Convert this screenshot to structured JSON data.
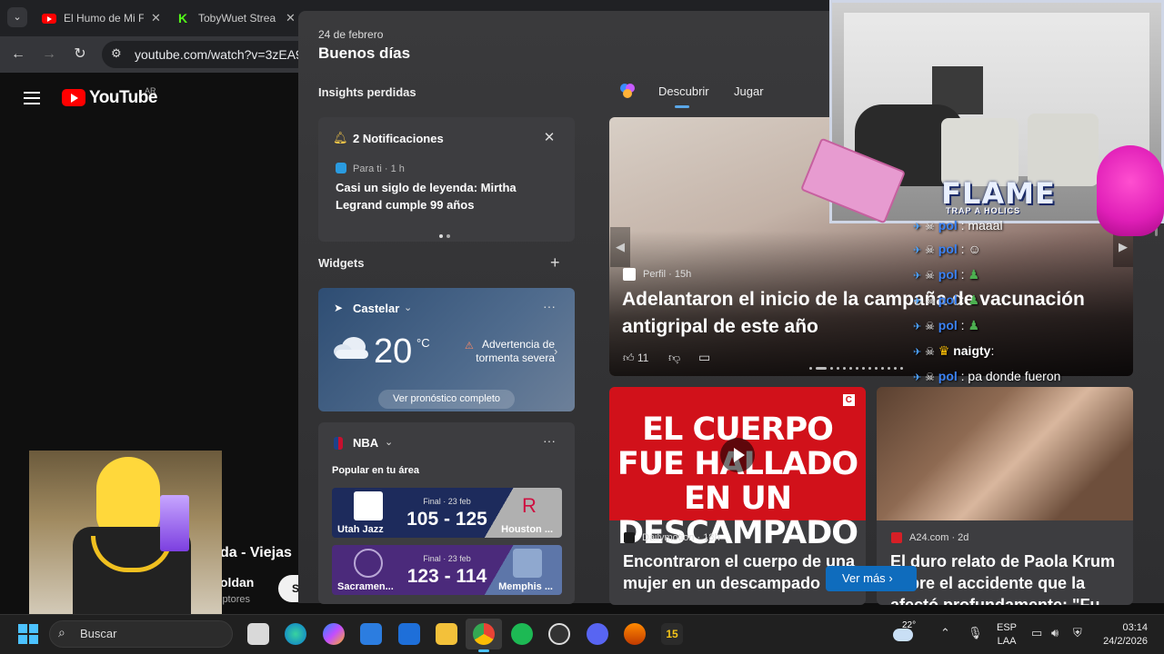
{
  "browser": {
    "tabs": [
      {
        "title": "El Humo de Mi F",
        "icon": "youtube-icon"
      },
      {
        "title": "TobyWuet Strea",
        "icon": "kick-icon"
      }
    ],
    "url": "youtube.com/watch?v=3zEA9T"
  },
  "youtube": {
    "logo_text": "YouTube",
    "region": "AR",
    "video_title_fragment": "da - Viejas",
    "channel_fragment": "oldan",
    "subs_fragment": "iptores",
    "subscribe_fragment": "S"
  },
  "widgets": {
    "date": "24 de febrero",
    "greeting": "Buenos días",
    "insights_label": "Insights perdidas",
    "notifications": {
      "title": "2 Notificaciones",
      "source": "Para ti · 1 h",
      "headline": "Casi un siglo de leyenda: Mirtha Legrand cumple 99 años"
    },
    "widgets_label": "Widgets",
    "weather": {
      "location": "Castelar",
      "temp": "20",
      "unit": "°C",
      "warning": "Advertencia de tormenta severa",
      "forecast_button": "Ver pronóstico completo"
    },
    "nba": {
      "title": "NBA",
      "popular": "Popular en tu área",
      "games": [
        {
          "status": "Final · 23 feb",
          "home": "Utah Jazz",
          "score": "105 - 125",
          "away": "Houston ...",
          "home_color": "#1d2b5c",
          "away_color": "#b0b0b0"
        },
        {
          "status": "Final · 23 feb",
          "home": "Sacramen...",
          "score": "123 - 114",
          "away": "Memphis ...",
          "home_color": "#4b2a7b",
          "away_color": "#5d76a9"
        }
      ]
    },
    "news_tabs": [
      "Descubrir",
      "Jugar"
    ],
    "hero": {
      "source": "Perfil · 15h",
      "title": "Adelantaron el inicio de la campaña de vacunación antigripal de este año",
      "likes": "11"
    },
    "cards": [
      {
        "image_text": "EL CUERPO FUE HALLADO EN UN DESCAMPADO",
        "image_logo": "C",
        "source": "Dailymotion · 18h",
        "title": "Encontraron el cuerpo de una mujer en un descampado"
      },
      {
        "source": "A24.com · 2d",
        "title": "El duro relato de Paola Krum sobre el accidente que la afectó profundamente: \"Fu"
      }
    ],
    "see_more": "Ver más"
  },
  "overlay": {
    "logo": "FLAME",
    "logo_sub": "TRAP A HOLICS",
    "chat": [
      {
        "user": "pol",
        "text": ": maaal"
      },
      {
        "user": "pol",
        "text": ":"
      },
      {
        "user": "pol",
        "text": ":"
      },
      {
        "user": "pol",
        "text": ":"
      },
      {
        "user": "pol",
        "text": ":"
      },
      {
        "user": "naigty",
        "text": ":"
      },
      {
        "user": "pol",
        "text": ": pa donde fueron"
      }
    ]
  },
  "taskbar": {
    "search_placeholder": "Buscar",
    "weather_temp": "22°",
    "lang_1": "ESP",
    "lang_2": "LAA",
    "time": "03:14",
    "date": "24/2/2026",
    "app_badge": "15"
  }
}
